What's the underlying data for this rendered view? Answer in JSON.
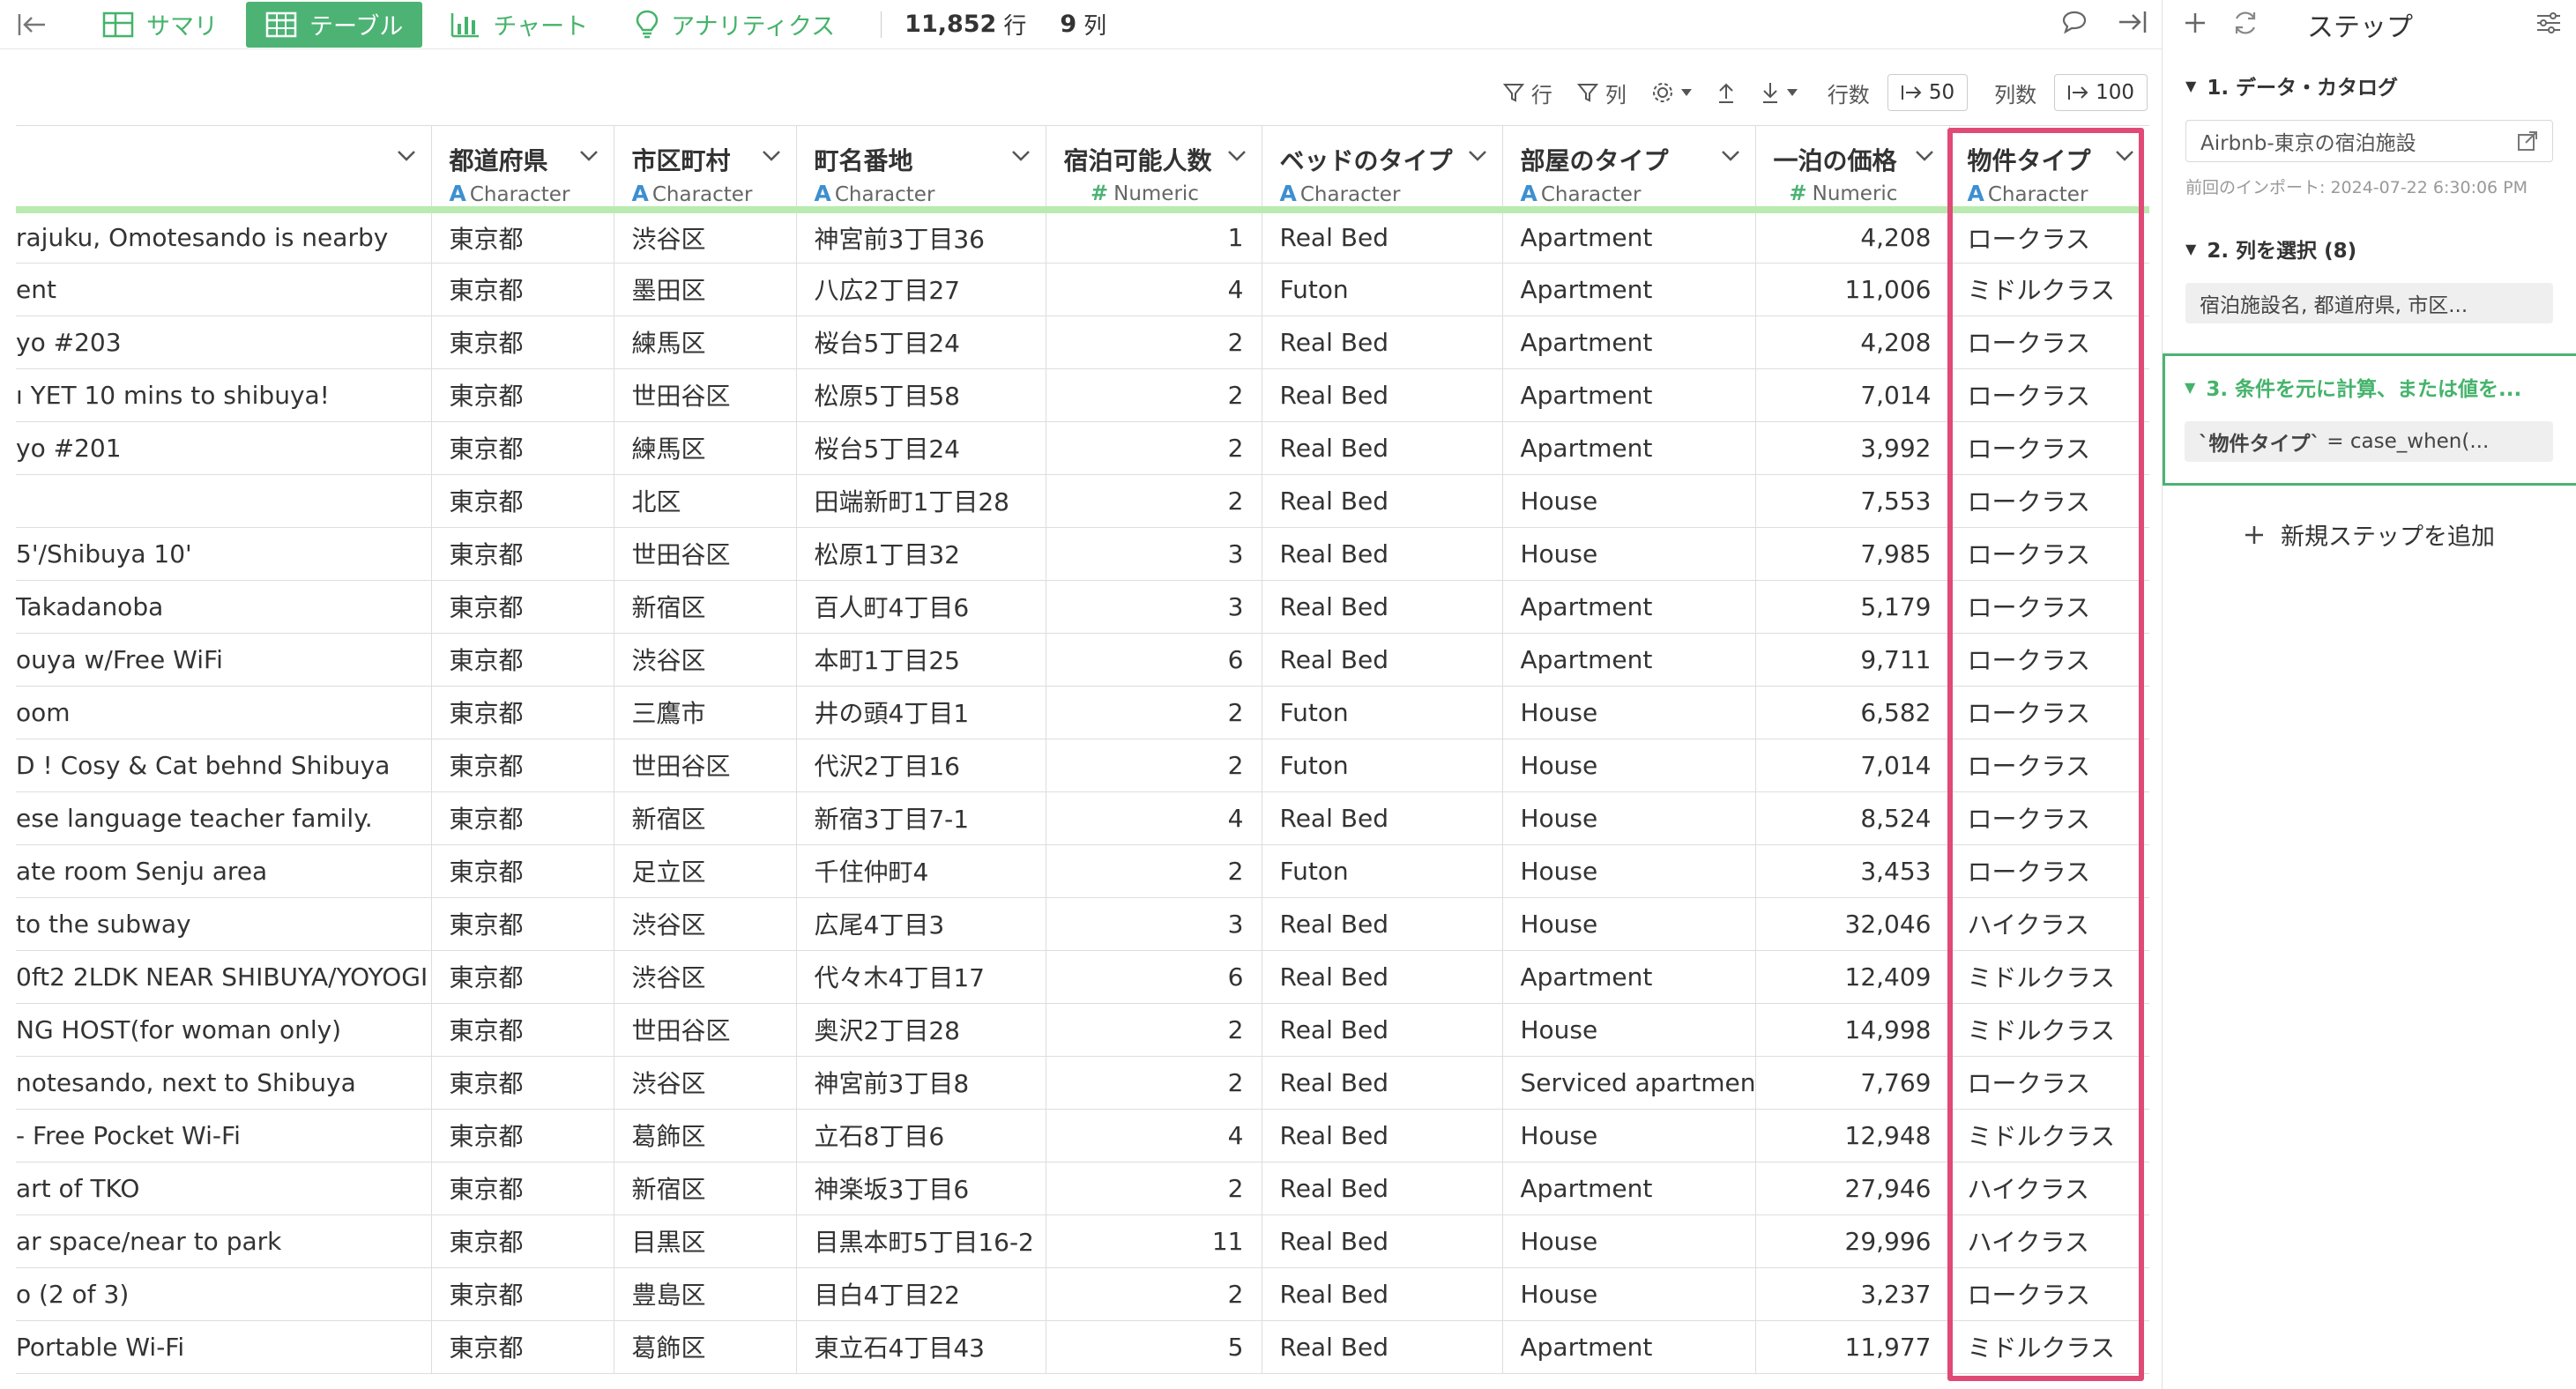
{
  "toolbar": {
    "tabs": [
      {
        "label": "サマリ"
      },
      {
        "label": "テーブル"
      },
      {
        "label": "チャート"
      },
      {
        "label": "アナリティクス"
      }
    ],
    "rows_count": "11,852",
    "rows_unit": "行",
    "cols_count": "9",
    "cols_unit": "列"
  },
  "table_toolbar": {
    "row_filter": "行",
    "col_filter": "列",
    "rows_label": "行数",
    "rows_value": "50",
    "cols_label": "列数",
    "cols_value": "100"
  },
  "columns": [
    {
      "name": "",
      "type": ""
    },
    {
      "name": "都道府県",
      "type": "Character"
    },
    {
      "name": "市区町村",
      "type": "Character"
    },
    {
      "name": "町名番地",
      "type": "Character"
    },
    {
      "name": "宿泊可能人数",
      "type": "Numeric"
    },
    {
      "name": "ベッドのタイプ",
      "type": "Character"
    },
    {
      "name": "部屋のタイプ",
      "type": "Character"
    },
    {
      "name": "一泊の価格",
      "type": "Numeric"
    },
    {
      "name": "物件タイプ",
      "type": "Character"
    }
  ],
  "rows": [
    [
      "rajuku, Omotesando is nearby",
      "東京都",
      "渋谷区",
      "神宮前3丁目36",
      "1",
      "Real Bed",
      "Apartment",
      "4,208",
      "ロークラス"
    ],
    [
      "ent",
      "東京都",
      "墨田区",
      "八広2丁目27",
      "4",
      "Futon",
      "Apartment",
      "11,006",
      "ミドルクラス"
    ],
    [
      "yo #203",
      "東京都",
      "練馬区",
      "桜台5丁目24",
      "2",
      "Real Bed",
      "Apartment",
      "4,208",
      "ロークラス"
    ],
    [
      "ı YET 10 mins to shibuya!",
      "東京都",
      "世田谷区",
      "松原5丁目58",
      "2",
      "Real Bed",
      "Apartment",
      "7,014",
      "ロークラス"
    ],
    [
      "yo #201",
      "東京都",
      "練馬区",
      "桜台5丁目24",
      "2",
      "Real Bed",
      "Apartment",
      "3,992",
      "ロークラス"
    ],
    [
      "",
      "東京都",
      "北区",
      "田端新町1丁目28",
      "2",
      "Real Bed",
      "House",
      "7,553",
      "ロークラス"
    ],
    [
      "5'/Shibuya 10'",
      "東京都",
      "世田谷区",
      "松原1丁目32",
      "3",
      "Real Bed",
      "House",
      "7,985",
      "ロークラス"
    ],
    [
      "Takadanoba",
      "東京都",
      "新宿区",
      "百人町4丁目6",
      "3",
      "Real Bed",
      "Apartment",
      "5,179",
      "ロークラス"
    ],
    [
      "ouya w/Free WiFi",
      "東京都",
      "渋谷区",
      "本町1丁目25",
      "6",
      "Real Bed",
      "Apartment",
      "9,711",
      "ロークラス"
    ],
    [
      "oom",
      "東京都",
      "三鷹市",
      "井の頭4丁目1",
      "2",
      "Futon",
      "House",
      "6,582",
      "ロークラス"
    ],
    [
      "D ! Cosy & Cat behnd Shibuya",
      "東京都",
      "世田谷区",
      "代沢2丁目16",
      "2",
      "Futon",
      "House",
      "7,014",
      "ロークラス"
    ],
    [
      "ese language teacher family.",
      "東京都",
      "新宿区",
      "新宿3丁目7-1",
      "4",
      "Real Bed",
      "House",
      "8,524",
      "ロークラス"
    ],
    [
      "ate room Senju area",
      "東京都",
      "足立区",
      "千住仲町4",
      "2",
      "Futon",
      "House",
      "3,453",
      "ロークラス"
    ],
    [
      "to the subway",
      "東京都",
      "渋谷区",
      "広尾4丁目3",
      "3",
      "Real Bed",
      "House",
      "32,046",
      "ハイクラス"
    ],
    [
      "0ft2 2LDK NEAR SHIBUYA/YOYOGI",
      "東京都",
      "渋谷区",
      "代々木4丁目17",
      "6",
      "Real Bed",
      "Apartment",
      "12,409",
      "ミドルクラス"
    ],
    [
      "NG HOST(for woman only)",
      "東京都",
      "世田谷区",
      "奥沢2丁目28",
      "2",
      "Real Bed",
      "House",
      "14,998",
      "ミドルクラス"
    ],
    [
      "notesando, next to Shibuya",
      "東京都",
      "渋谷区",
      "神宮前3丁目8",
      "2",
      "Real Bed",
      "Serviced apartment",
      "7,769",
      "ロークラス"
    ],
    [
      "- Free Pocket Wi-Fi",
      "東京都",
      "葛飾区",
      "立石8丁目6",
      "4",
      "Real Bed",
      "House",
      "12,948",
      "ミドルクラス"
    ],
    [
      "art of TKO",
      "東京都",
      "新宿区",
      "神楽坂3丁目6",
      "2",
      "Real Bed",
      "Apartment",
      "27,946",
      "ハイクラス"
    ],
    [
      "ar space/near to park",
      "東京都",
      "目黒区",
      "目黒本町5丁目16-2",
      "11",
      "Real Bed",
      "House",
      "29,996",
      "ハイクラス"
    ],
    [
      "o (2 of 3)",
      "東京都",
      "豊島区",
      "目白4丁目22",
      "2",
      "Real Bed",
      "House",
      "3,237",
      "ロークラス"
    ],
    [
      "Portable Wi-Fi",
      "東京都",
      "葛飾区",
      "東立石4丁目43",
      "5",
      "Real Bed",
      "Apartment",
      "11,977",
      "ミドルクラス"
    ]
  ],
  "steps": {
    "title": "ステップ",
    "items": [
      {
        "title": "1. データ・カタログ",
        "box": "Airbnb-東京の宿泊施設",
        "sub": "前回のインポート: 2024-07-22 6:30:06 PM"
      },
      {
        "title": "2. 列を選択 (8)",
        "grey": "宿泊施設名, 都道府県, 市区..."
      },
      {
        "title": "3. 条件を元に計算、または値を...",
        "grey_code": "`物件タイプ`",
        "grey_rest": " = case_when(..."
      }
    ],
    "add_label": "新規ステップを追加"
  },
  "colors": {
    "accent": "#4db374",
    "highlight": "#e04a76",
    "type_char": "#3d8fd0"
  }
}
